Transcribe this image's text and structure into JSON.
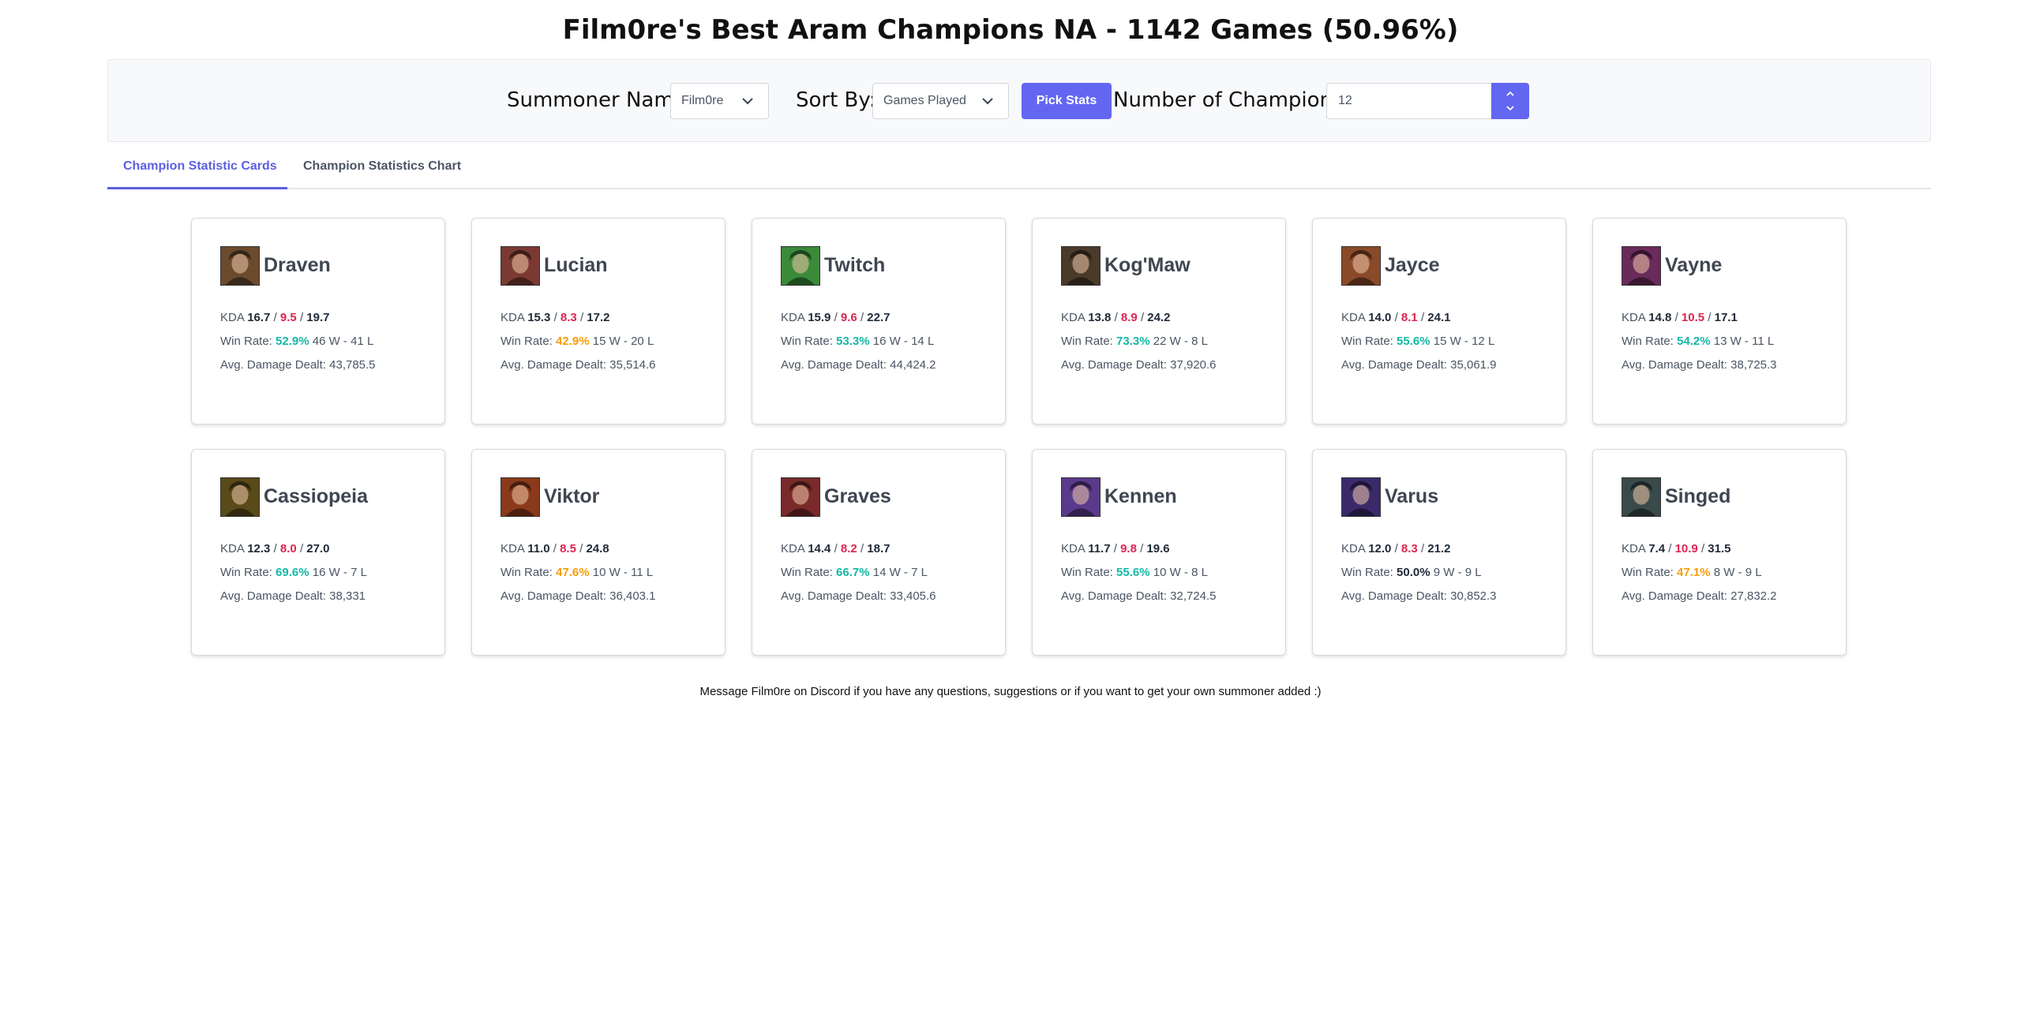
{
  "page_title": "Film0re's Best Aram Champions NA - 1142 Games (50.96%)",
  "controls": {
    "summoner_label": "Summoner Name:",
    "summoner_value": "Film0re",
    "sort_label": "Sort By:",
    "sort_value": "Games Played",
    "pick_button": "Pick Stats",
    "count_label": "Number of Champions:",
    "count_value": "12"
  },
  "tabs": [
    {
      "label": "Champion Statistic Cards",
      "active": true
    },
    {
      "label": "Champion Statistics Chart",
      "active": false
    }
  ],
  "stat_labels": {
    "kda": "KDA",
    "sep": "/",
    "win_rate": "Win Rate:",
    "damage": "Avg. Damage Dealt:"
  },
  "champions": [
    {
      "name": "Draven",
      "k": "16.7",
      "d": "9.5",
      "a": "19.7",
      "win_rate": "52.9%",
      "rate_class": "good",
      "record": "46 W - 41 L",
      "damage": "43,785.5",
      "color": "#6b4a2e"
    },
    {
      "name": "Lucian",
      "k": "15.3",
      "d": "8.3",
      "a": "17.2",
      "win_rate": "42.9%",
      "rate_class": "bad",
      "record": "15 W - 20 L",
      "damage": "35,514.6",
      "color": "#7a3a32"
    },
    {
      "name": "Twitch",
      "k": "15.9",
      "d": "9.6",
      "a": "22.7",
      "win_rate": "53.3%",
      "rate_class": "good",
      "record": "16 W - 14 L",
      "damage": "44,424.2",
      "color": "#3a8a3a"
    },
    {
      "name": "Kog'Maw",
      "k": "13.8",
      "d": "8.9",
      "a": "24.2",
      "win_rate": "73.3%",
      "rate_class": "good",
      "record": "22 W - 8 L",
      "damage": "37,920.6",
      "color": "#4a3a2a"
    },
    {
      "name": "Jayce",
      "k": "14.0",
      "d": "8.1",
      "a": "24.1",
      "win_rate": "55.6%",
      "rate_class": "good",
      "record": "15 W - 12 L",
      "damage": "35,061.9",
      "color": "#8a4a2a"
    },
    {
      "name": "Vayne",
      "k": "14.8",
      "d": "10.5",
      "a": "17.1",
      "win_rate": "54.2%",
      "rate_class": "good",
      "record": "13 W - 11 L",
      "damage": "38,725.3",
      "color": "#6a2a5a"
    },
    {
      "name": "Cassiopeia",
      "k": "12.3",
      "d": "8.0",
      "a": "27.0",
      "win_rate": "69.6%",
      "rate_class": "good",
      "record": "16 W - 7 L",
      "damage": "38,331",
      "color": "#5a4a1a"
    },
    {
      "name": "Viktor",
      "k": "11.0",
      "d": "8.5",
      "a": "24.8",
      "win_rate": "47.6%",
      "rate_class": "bad",
      "record": "10 W - 11 L",
      "damage": "36,403.1",
      "color": "#8a3a1a"
    },
    {
      "name": "Graves",
      "k": "14.4",
      "d": "8.2",
      "a": "18.7",
      "win_rate": "66.7%",
      "rate_class": "good",
      "record": "14 W - 7 L",
      "damage": "33,405.6",
      "color": "#7a2a2a"
    },
    {
      "name": "Kennen",
      "k": "11.7",
      "d": "9.8",
      "a": "19.6",
      "win_rate": "55.6%",
      "rate_class": "good",
      "record": "10 W - 8 L",
      "damage": "32,724.5",
      "color": "#5a3a8a"
    },
    {
      "name": "Varus",
      "k": "12.0",
      "d": "8.3",
      "a": "21.2",
      "win_rate": "50.0%",
      "rate_class": "neutral",
      "record": "9 W - 9 L",
      "damage": "30,852.3",
      "color": "#3a2a6a"
    },
    {
      "name": "Singed",
      "k": "7.4",
      "d": "10.9",
      "a": "31.5",
      "win_rate": "47.1%",
      "rate_class": "bad",
      "record": "8 W - 9 L",
      "damage": "27,832.2",
      "color": "#3a4a4a"
    }
  ],
  "footer": "Message Film0re on Discord if you have any questions, suggestions or if you want to get your own summoner added :)"
}
